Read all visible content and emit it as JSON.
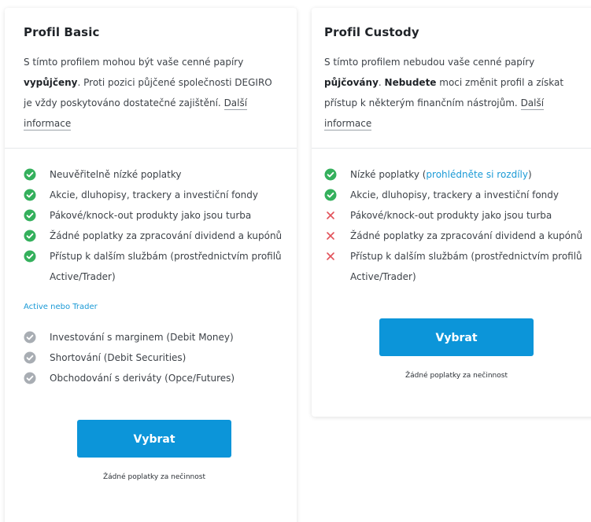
{
  "basic": {
    "title": "Profil Basic",
    "desc_part1": "S tímto profilem mohou být vaše cenné papíry ",
    "desc_bold1": "vypůjčeny",
    "desc_part2": ". Proti pozici půjčené společnosti DEGIRO je vždy poskytováno dostatečné zajištění. ",
    "more_link": "Další informace",
    "features": [
      {
        "status": "included",
        "text": "Neuvěřitelně nízké poplatky"
      },
      {
        "status": "included",
        "text": "Akcie, dluhopisy, trackery a investiční fondy"
      },
      {
        "status": "included",
        "text": "Pákové/knock-out produkty jako jsou turba"
      },
      {
        "status": "included",
        "text": "Žádné poplatky za zpracování dividend a kupónů"
      },
      {
        "status": "included",
        "text": "Přístup k dalším službám (prostřednictvím profilů Active/Trader)"
      }
    ],
    "subheading": "Active nebo Trader",
    "extra_features": [
      {
        "status": "optional",
        "text": "Investování s marginem (Debit Money)"
      },
      {
        "status": "optional",
        "text": "Shortování (Debit Securities)"
      },
      {
        "status": "optional",
        "text": "Obchodování s deriváty (Opce/Futures)"
      }
    ],
    "button_label": "Vybrat",
    "fine_print": "Žádné poplatky za nečinnost"
  },
  "custody": {
    "title": "Profil Custody",
    "desc_part1": "S tímto profilem nebudou vaše cenné papíry ",
    "desc_bold1": "půjčovány",
    "desc_part2": ". ",
    "desc_bold2": "Nebudete",
    "desc_part3": " moci změnit profil a získat přístup k některým finančním nástrojům. ",
    "more_link": "Další informace",
    "feature0_text": "Nízké poplatky (",
    "feature0_link": "prohlédněte si rozdíly",
    "feature0_end": ")",
    "features": [
      {
        "status": "included",
        "text": "Akcie, dluhopisy, trackery a investiční fondy"
      },
      {
        "status": "excluded",
        "text": "Pákové/knock-out produkty jako jsou turba"
      },
      {
        "status": "excluded",
        "text": "Žádné poplatky za zpracování dividend a kupónů"
      },
      {
        "status": "excluded",
        "text": "Přístup k dalším službám (prostřednictvím profilů Active/Trader)"
      }
    ],
    "button_label": "Vybrat",
    "fine_print": "Žádné poplatky za nečinnost"
  },
  "colors": {
    "check": "#34b05c",
    "cross": "#e2525a",
    "optional": "#a8adb3",
    "accent": "#1b9ad6",
    "button": "#0c95d9"
  },
  "icons": {
    "included": "check-circle-icon",
    "excluded": "cross-icon",
    "optional": "grey-check-circle-icon"
  }
}
